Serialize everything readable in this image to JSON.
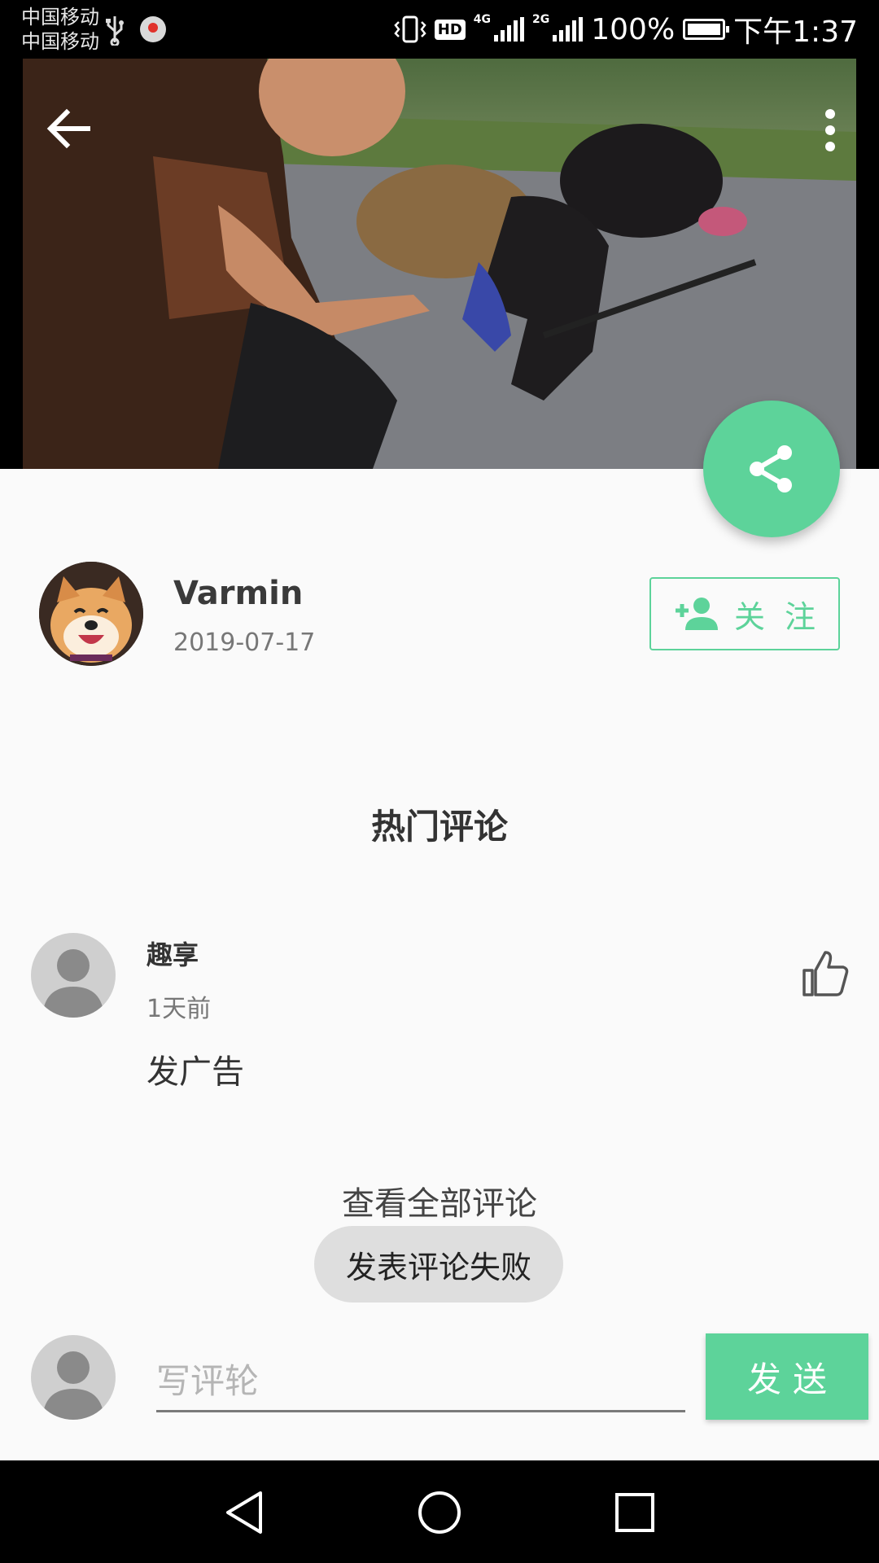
{
  "status_bar": {
    "carrier1": "中国移动",
    "carrier2": "中国移动",
    "hd": "HD",
    "net1": "4G",
    "net2": "2G",
    "battery": "100%",
    "time": "下午1:37"
  },
  "header": {
    "back_icon": "arrow-left-icon",
    "more_icon": "more-vertical-icon",
    "share_icon": "share-icon"
  },
  "author": {
    "name": "Varmin",
    "date": "2019-07-17",
    "follow_label": "关注"
  },
  "comments": {
    "section_title": "热门评论",
    "items": [
      {
        "user": "趣享",
        "time": "1天前",
        "text": "发广告"
      }
    ],
    "view_all": "查看全部评论"
  },
  "toast": "发表评论失败",
  "input": {
    "placeholder": "写评轮",
    "value": "",
    "send_label": "发送"
  },
  "colors": {
    "accent": "#5dd39a",
    "background": "#fafafa"
  }
}
